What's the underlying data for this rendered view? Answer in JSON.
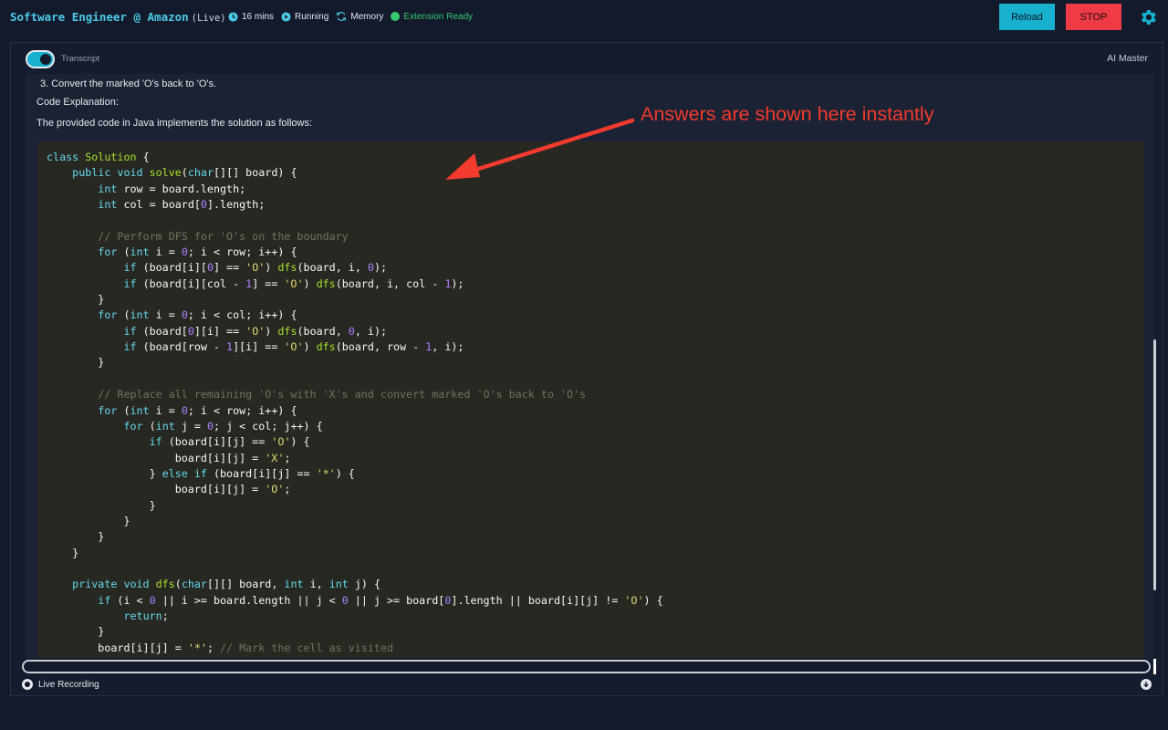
{
  "header": {
    "title": "Software Engineer @ Amazon",
    "live_tag": "(Live)",
    "time": "16 mins",
    "running": "Running",
    "memory": "Memory",
    "extension": "Extension Ready",
    "reload_label": "Reload",
    "stop_label": "STOP"
  },
  "panel": {
    "toggle_label": "Transcript",
    "assistant_label": "AI Master"
  },
  "content": {
    "step3": "3. Convert the marked 'O's back to 'O's.",
    "explanation_heading": "Code Explanation:",
    "intro": "The provided code in Java implements the solution as follows:"
  },
  "annotation": "Answers are shown here instantly",
  "footer": {
    "recording_label": "Live Recording"
  },
  "code": [
    [
      [
        "kw",
        "class "
      ],
      [
        "cls",
        "Solution"
      ],
      [
        "p",
        " {"
      ]
    ],
    [
      [
        "p",
        "    "
      ],
      [
        "kw",
        "public void "
      ],
      [
        "fn",
        "solve"
      ],
      [
        "p",
        "("
      ],
      [
        "kw",
        "char"
      ],
      [
        "p",
        "[][] board) {"
      ]
    ],
    [
      [
        "p",
        "        "
      ],
      [
        "kw",
        "int"
      ],
      [
        "p",
        " row = board.length;"
      ]
    ],
    [
      [
        "p",
        "        "
      ],
      [
        "kw",
        "int"
      ],
      [
        "p",
        " col = board["
      ],
      [
        "nm",
        "0"
      ],
      [
        "p",
        "].length;"
      ]
    ],
    [
      [
        "p",
        ""
      ]
    ],
    [
      [
        "p",
        "        "
      ],
      [
        "cm",
        "// Perform DFS for 'O's on the boundary"
      ]
    ],
    [
      [
        "p",
        "        "
      ],
      [
        "kw",
        "for"
      ],
      [
        "p",
        " ("
      ],
      [
        "kw",
        "int"
      ],
      [
        "p",
        " i = "
      ],
      [
        "nm",
        "0"
      ],
      [
        "p",
        "; i < row; i++) {"
      ]
    ],
    [
      [
        "p",
        "            "
      ],
      [
        "kw",
        "if"
      ],
      [
        "p",
        " (board[i]["
      ],
      [
        "nm",
        "0"
      ],
      [
        "p",
        "] == "
      ],
      [
        "str",
        "'O'"
      ],
      [
        "p",
        ") "
      ],
      [
        "fn",
        "dfs"
      ],
      [
        "p",
        "(board, i, "
      ],
      [
        "nm",
        "0"
      ],
      [
        "p",
        ");"
      ]
    ],
    [
      [
        "p",
        "            "
      ],
      [
        "kw",
        "if"
      ],
      [
        "p",
        " (board[i][col - "
      ],
      [
        "nm",
        "1"
      ],
      [
        "p",
        "] == "
      ],
      [
        "str",
        "'O'"
      ],
      [
        "p",
        ") "
      ],
      [
        "fn",
        "dfs"
      ],
      [
        "p",
        "(board, i, col - "
      ],
      [
        "nm",
        "1"
      ],
      [
        "p",
        ");"
      ]
    ],
    [
      [
        "p",
        "        }"
      ]
    ],
    [
      [
        "p",
        "        "
      ],
      [
        "kw",
        "for"
      ],
      [
        "p",
        " ("
      ],
      [
        "kw",
        "int"
      ],
      [
        "p",
        " i = "
      ],
      [
        "nm",
        "0"
      ],
      [
        "p",
        "; i < col; i++) {"
      ]
    ],
    [
      [
        "p",
        "            "
      ],
      [
        "kw",
        "if"
      ],
      [
        "p",
        " (board["
      ],
      [
        "nm",
        "0"
      ],
      [
        "p",
        "][i] == "
      ],
      [
        "str",
        "'O'"
      ],
      [
        "p",
        ") "
      ],
      [
        "fn",
        "dfs"
      ],
      [
        "p",
        "(board, "
      ],
      [
        "nm",
        "0"
      ],
      [
        "p",
        ", i);"
      ]
    ],
    [
      [
        "p",
        "            "
      ],
      [
        "kw",
        "if"
      ],
      [
        "p",
        " (board[row - "
      ],
      [
        "nm",
        "1"
      ],
      [
        "p",
        "][i] == "
      ],
      [
        "str",
        "'O'"
      ],
      [
        "p",
        ") "
      ],
      [
        "fn",
        "dfs"
      ],
      [
        "p",
        "(board, row - "
      ],
      [
        "nm",
        "1"
      ],
      [
        "p",
        ", i);"
      ]
    ],
    [
      [
        "p",
        "        }"
      ]
    ],
    [
      [
        "p",
        ""
      ]
    ],
    [
      [
        "p",
        "        "
      ],
      [
        "cm",
        "// Replace all remaining 'O's with 'X's and convert marked 'O's back to 'O's"
      ]
    ],
    [
      [
        "p",
        "        "
      ],
      [
        "kw",
        "for"
      ],
      [
        "p",
        " ("
      ],
      [
        "kw",
        "int"
      ],
      [
        "p",
        " i = "
      ],
      [
        "nm",
        "0"
      ],
      [
        "p",
        "; i < row; i++) {"
      ]
    ],
    [
      [
        "p",
        "            "
      ],
      [
        "kw",
        "for"
      ],
      [
        "p",
        " ("
      ],
      [
        "kw",
        "int"
      ],
      [
        "p",
        " j = "
      ],
      [
        "nm",
        "0"
      ],
      [
        "p",
        "; j < col; j++) {"
      ]
    ],
    [
      [
        "p",
        "                "
      ],
      [
        "kw",
        "if"
      ],
      [
        "p",
        " (board[i][j] == "
      ],
      [
        "str",
        "'O'"
      ],
      [
        "p",
        ") {"
      ]
    ],
    [
      [
        "p",
        "                    board[i][j] = "
      ],
      [
        "str",
        "'X'"
      ],
      [
        "p",
        ";"
      ]
    ],
    [
      [
        "p",
        "                } "
      ],
      [
        "kw",
        "else if"
      ],
      [
        "p",
        " (board[i][j] == "
      ],
      [
        "str",
        "'*'"
      ],
      [
        "p",
        ") {"
      ]
    ],
    [
      [
        "p",
        "                    board[i][j] = "
      ],
      [
        "str",
        "'O'"
      ],
      [
        "p",
        ";"
      ]
    ],
    [
      [
        "p",
        "                }"
      ]
    ],
    [
      [
        "p",
        "            }"
      ]
    ],
    [
      [
        "p",
        "        }"
      ]
    ],
    [
      [
        "p",
        "    }"
      ]
    ],
    [
      [
        "p",
        ""
      ]
    ],
    [
      [
        "p",
        "    "
      ],
      [
        "kw",
        "private void "
      ],
      [
        "fn",
        "dfs"
      ],
      [
        "p",
        "("
      ],
      [
        "kw",
        "char"
      ],
      [
        "p",
        "[][] board, "
      ],
      [
        "kw",
        "int"
      ],
      [
        "p",
        " i, "
      ],
      [
        "kw",
        "int"
      ],
      [
        "p",
        " j) {"
      ]
    ],
    [
      [
        "p",
        "        "
      ],
      [
        "kw",
        "if"
      ],
      [
        "p",
        " (i < "
      ],
      [
        "nm",
        "0"
      ],
      [
        "p",
        " || i >= board.length || j < "
      ],
      [
        "nm",
        "0"
      ],
      [
        "p",
        " || j >= board["
      ],
      [
        "nm",
        "0"
      ],
      [
        "p",
        "].length || board[i][j] != "
      ],
      [
        "str",
        "'O'"
      ],
      [
        "p",
        ") {"
      ]
    ],
    [
      [
        "p",
        "            "
      ],
      [
        "kw",
        "return"
      ],
      [
        "p",
        ";"
      ]
    ],
    [
      [
        "p",
        "        }"
      ]
    ],
    [
      [
        "p",
        "        board[i][j] = "
      ],
      [
        "str",
        "'*'"
      ],
      [
        "p",
        "; "
      ],
      [
        "cm",
        "// Mark the cell as visited"
      ]
    ]
  ]
}
